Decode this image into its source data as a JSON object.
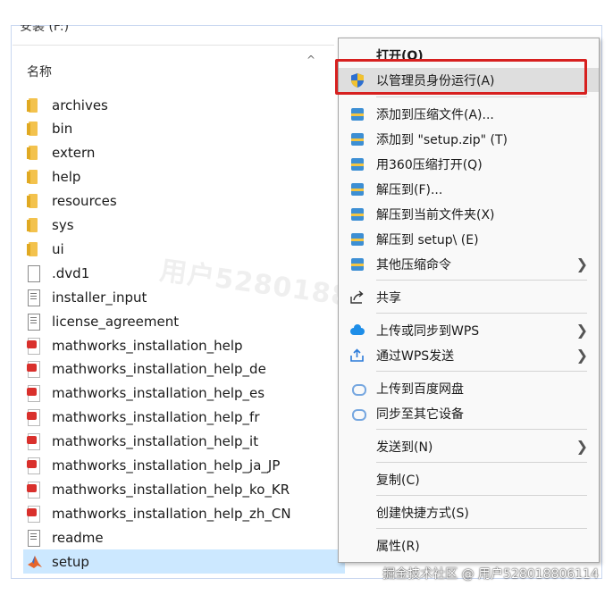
{
  "explorer": {
    "top_text": "安装 (F:)",
    "column_header": "名称",
    "files": [
      {
        "name": "archives",
        "type": "folder"
      },
      {
        "name": "bin",
        "type": "folder"
      },
      {
        "name": "extern",
        "type": "folder"
      },
      {
        "name": "help",
        "type": "folder"
      },
      {
        "name": "resources",
        "type": "folder"
      },
      {
        "name": "sys",
        "type": "folder"
      },
      {
        "name": "ui",
        "type": "folder"
      },
      {
        "name": ".dvd1",
        "type": "file"
      },
      {
        "name": "installer_input",
        "type": "text"
      },
      {
        "name": "license_agreement",
        "type": "text"
      },
      {
        "name": "mathworks_installation_help",
        "type": "pdf"
      },
      {
        "name": "mathworks_installation_help_de",
        "type": "pdf"
      },
      {
        "name": "mathworks_installation_help_es",
        "type": "pdf"
      },
      {
        "name": "mathworks_installation_help_fr",
        "type": "pdf"
      },
      {
        "name": "mathworks_installation_help_it",
        "type": "pdf"
      },
      {
        "name": "mathworks_installation_help_ja_JP",
        "type": "pdf"
      },
      {
        "name": "mathworks_installation_help_ko_KR",
        "type": "pdf"
      },
      {
        "name": "mathworks_installation_help_zh_CN",
        "type": "pdf"
      },
      {
        "name": "readme",
        "type": "text"
      },
      {
        "name": "setup",
        "type": "matlab",
        "selected": true
      }
    ]
  },
  "watermark": "用户528018806114",
  "context_menu": {
    "open": "打开(O)",
    "run_as_admin": "以管理员身份运行(A)",
    "add_to_archive": "添加到压缩文件(A)...",
    "add_to_setup_zip": "添加到 \"setup.zip\" (T)",
    "compress_360": "用360压缩打开(Q)",
    "extract_to": "解压到(F)...",
    "extract_here": "解压到当前文件夹(X)",
    "extract_to_setup": "解压到 setup\\ (E)",
    "other_commands": "其他压缩命令",
    "share": "共享",
    "upload_wps": "上传或同步到WPS",
    "send_wps": "通过WPS发送",
    "upload_baidu": "上传到百度网盘",
    "sync_devices": "同步至其它设备",
    "send_to": "发送到(N)",
    "copy": "复制(C)",
    "create_shortcut": "创建快捷方式(S)",
    "properties": "属性(R)"
  },
  "footer": "掘金技术社区 @ 用户528018806114",
  "colors": {
    "highlight_box": "#d7201f",
    "selection": "#cce8ff",
    "folder": "#f3c24d"
  }
}
